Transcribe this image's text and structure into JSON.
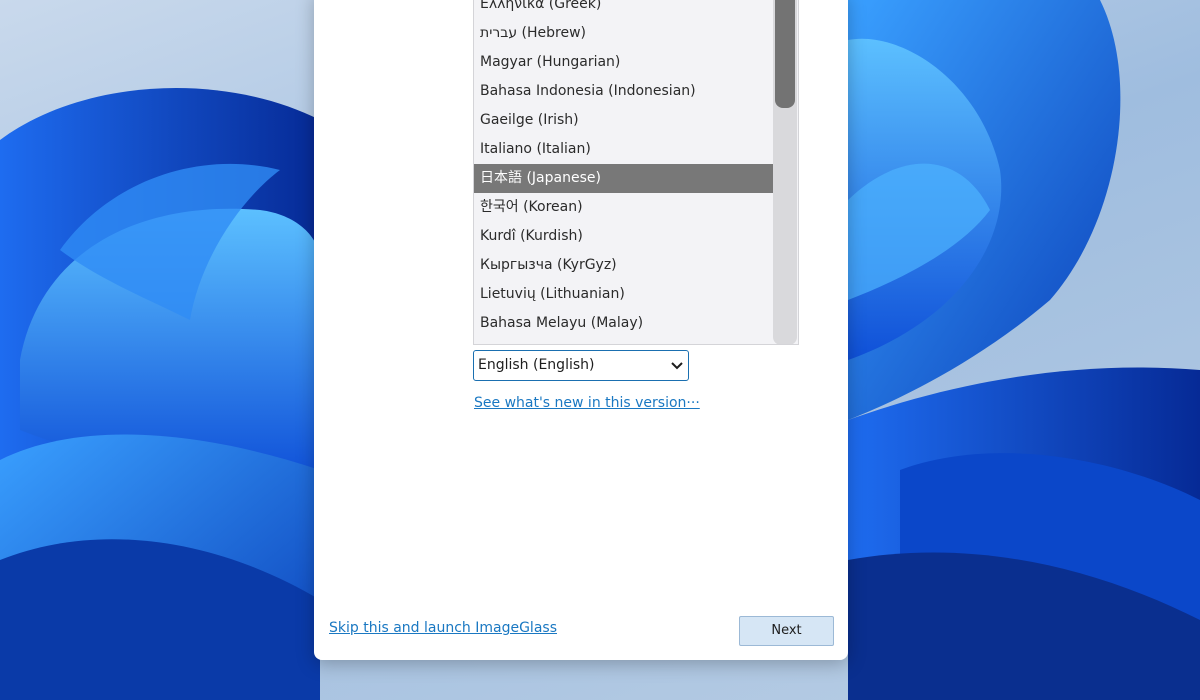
{
  "languages": [
    {
      "label": "Ελληνικά (Greek)"
    },
    {
      "label": "עברית (Hebrew)"
    },
    {
      "label": "Magyar (Hungarian)"
    },
    {
      "label": "Bahasa Indonesia (Indonesian)"
    },
    {
      "label": "Gaeilge (Irish)"
    },
    {
      "label": "Italiano (Italian)"
    },
    {
      "label": "日本語 (Japanese)",
      "selected": true
    },
    {
      "label": "한국어 (Korean)"
    },
    {
      "label": "Kurdî (Kurdish)"
    },
    {
      "label": "Кыргызча (KyrGyz)"
    },
    {
      "label": "Lietuvių (Lithuanian)"
    },
    {
      "label": "Bahasa Melayu (Malay)"
    }
  ],
  "language_select": {
    "value": "English (English)"
  },
  "links": {
    "whats_new": "See what's new in this version···",
    "skip": "Skip this and launch ImageGlass"
  },
  "buttons": {
    "next": "Next"
  },
  "colors": {
    "selection": "#787878",
    "link": "#1a78c2",
    "next_button_bg": "#d6e6f5",
    "accent_border": "#1a6fb0"
  },
  "icons": {
    "select_arrow": "chevron-down-icon"
  }
}
